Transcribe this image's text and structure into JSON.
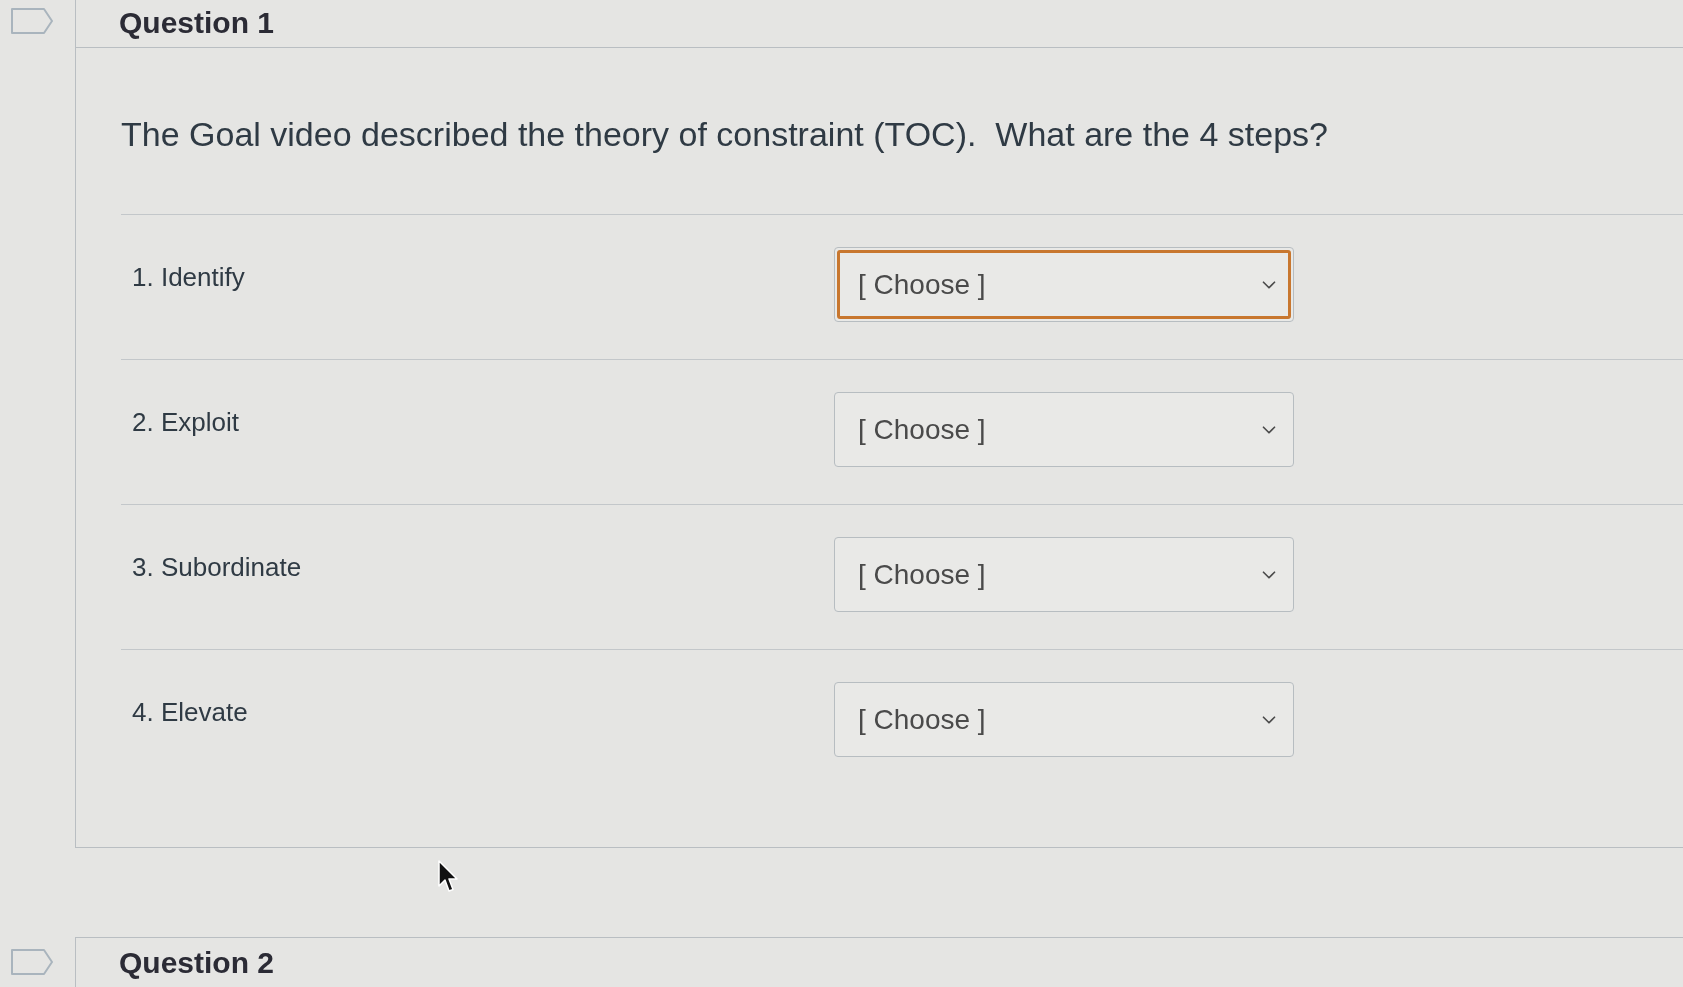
{
  "questions": [
    {
      "title": "Question 1",
      "prompt": "The Goal video described the theory of constraint (TOC).  What are the 4 steps?",
      "steps": [
        {
          "label": "1. Identify",
          "value": "[ Choose ]",
          "focused": true
        },
        {
          "label": "2. Exploit",
          "value": "[ Choose ]",
          "focused": false
        },
        {
          "label": "3. Subordinate",
          "value": "[ Choose ]",
          "focused": false
        },
        {
          "label": "4. Elevate",
          "value": "[ Choose ]",
          "focused": false
        }
      ]
    },
    {
      "title": "Question 2"
    }
  ]
}
